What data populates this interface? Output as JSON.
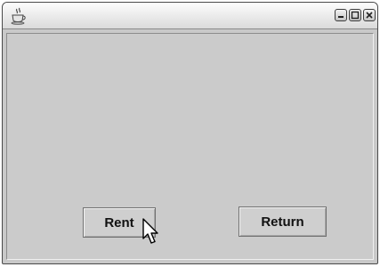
{
  "window": {
    "title": "",
    "icon": "java-coffee-cup-icon",
    "controls": [
      "minimize-icon",
      "maximize-icon",
      "close-icon"
    ]
  },
  "buttons": {
    "rent_label": "Rent",
    "return_label": "Return"
  },
  "colors": {
    "content_background": "#cbcbcb",
    "titlebar_top": "#fdfdfd",
    "titlebar_bottom": "#dadada",
    "button_background": "#cfcfcf"
  }
}
